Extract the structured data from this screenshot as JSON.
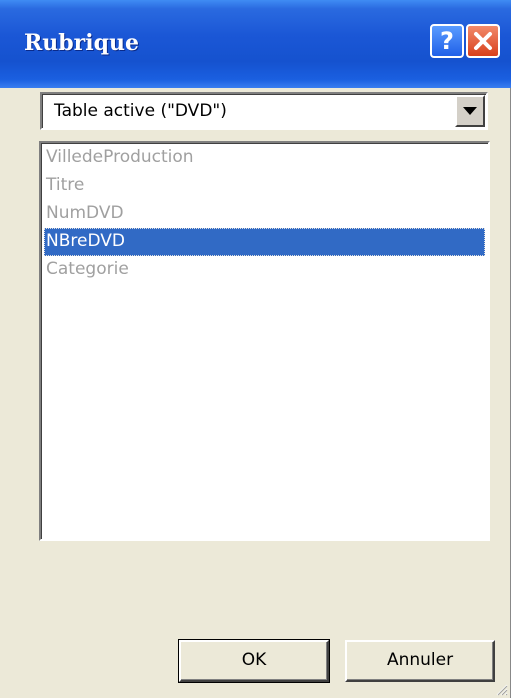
{
  "window": {
    "title": "Rubrique"
  },
  "titlebar_buttons": {
    "help": "?",
    "close": "✕"
  },
  "table_select": {
    "value": "Table active (\"DVD\")"
  },
  "fields_list": {
    "items": [
      {
        "label": "VilledeProduction",
        "state": "disabled"
      },
      {
        "label": "Titre",
        "state": "disabled"
      },
      {
        "label": "NumDVD",
        "state": "disabled"
      },
      {
        "label": "NBreDVD",
        "state": "selected"
      },
      {
        "label": "Categorie",
        "state": "disabled"
      }
    ]
  },
  "buttons": {
    "ok": "OK",
    "cancel": "Annuler"
  },
  "colors": {
    "titlebar": "#1552cf",
    "selection": "#316ac5",
    "dialog_bg": "#ece9d8",
    "disabled_text": "#a0a0a0"
  }
}
